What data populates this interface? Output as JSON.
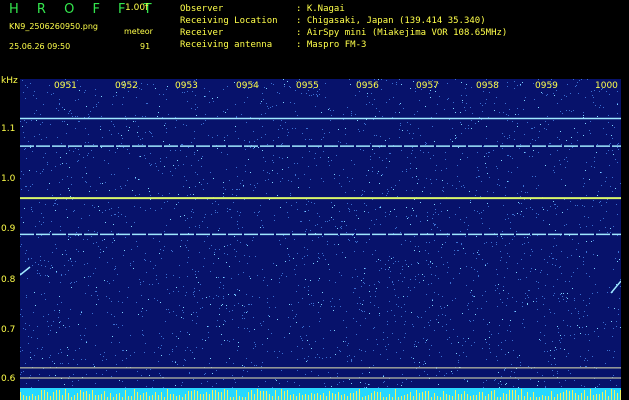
{
  "header": {
    "title": "H R O F F T",
    "version": "1.00f",
    "filename": "KN9_2506260950.png",
    "meteor_label": "meteor",
    "datetime": "25.06.26 09:50",
    "count": "91",
    "info": [
      {
        "label": "Observer",
        "value": ": K.Nagai"
      },
      {
        "label": "Receiving Location",
        "value": ": Chigasaki, Japan (139.414 35.340)"
      },
      {
        "label": "Receiver",
        "value": ": AirSpy mini (Miakejima VOR 108.65MHz)"
      },
      {
        "label": "Receiving antenna",
        "value": ": Maspro FM-3"
      }
    ]
  },
  "axis": {
    "unit": "kHz",
    "y_ticks": [
      "1.1",
      "1.0",
      "0.9",
      "0.8",
      "0.7",
      "0.6"
    ],
    "x_ticks": [
      "0951",
      "0952",
      "0953",
      "0954",
      "0955",
      "0956",
      "0957",
      "0958",
      "0959",
      "1000"
    ]
  },
  "colors": {
    "background": "#07126b",
    "carrier": "#9fe8ff",
    "text": "#ffff4a",
    "title": "#33e64d"
  },
  "spectrogram": {
    "carriers_khz": [
      1.115,
      1.06,
      0.957,
      0.885
    ],
    "reference_lines_khz": [
      0.62,
      0.6
    ]
  }
}
